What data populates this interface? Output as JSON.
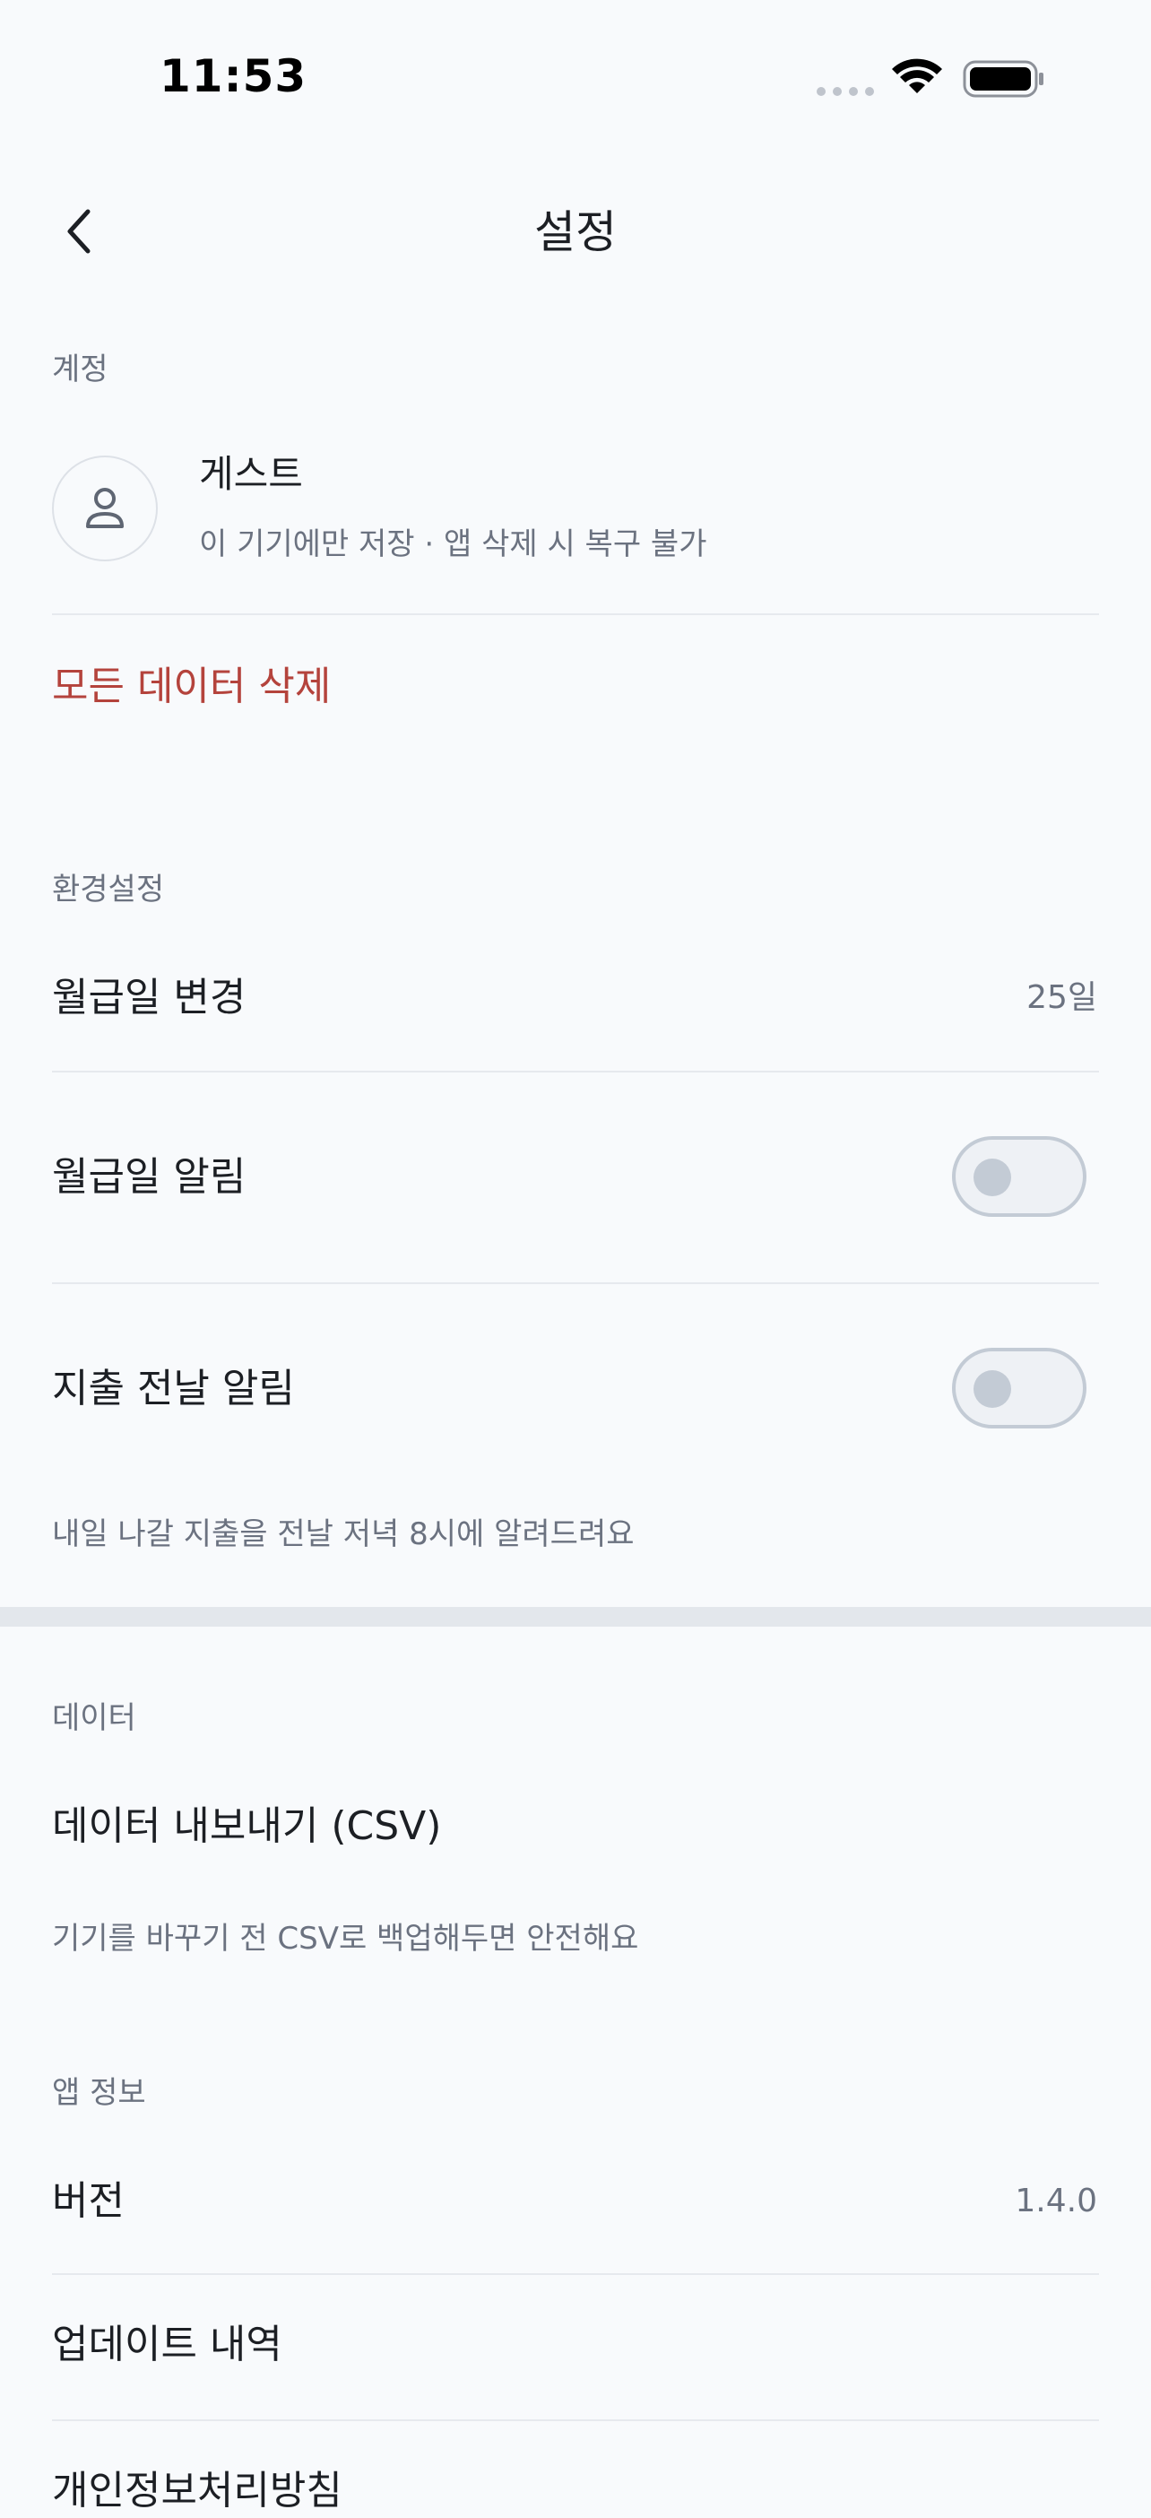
{
  "status_bar": {
    "time": "11:53"
  },
  "nav": {
    "title": "설정",
    "back_icon": "chevron-left-icon"
  },
  "account": {
    "section_title": "계정",
    "name": "게스트",
    "subtitle": "이 기기에만 저장 · 앱 삭제 시 복구 불가",
    "avatar_icon": "user-icon",
    "delete_all_label": "모든 데이터 삭제"
  },
  "preferences": {
    "section_title": "환경설정",
    "payday_change_label": "월급일 변경",
    "payday_value": "25일",
    "payday_alert_label": "월급일 알림",
    "payday_alert_on": false,
    "expense_alert_label": "지출 전날 알림",
    "expense_alert_on": false,
    "expense_alert_help": "내일 나갈 지출을 전날 저녁 8시에 알려드려요"
  },
  "data_section": {
    "section_title": "데이터",
    "export_label": "데이터 내보내기 (CSV)",
    "export_help": "기기를 바꾸기 전 CSV로 백업해두면 안전해요"
  },
  "app_info": {
    "section_title": "앱 정보",
    "version_label": "버전",
    "version_value": "1.4.0",
    "updates_label": "업데이트 내역",
    "privacy_label": "개인정보처리방침"
  },
  "colors": {
    "background": "#f8fafc",
    "text_primary": "#1c1f24",
    "text_secondary": "#6b7280",
    "danger": "#b4433c",
    "toggle_off": "#c3cbd5",
    "divider": "#e6e9ee"
  }
}
